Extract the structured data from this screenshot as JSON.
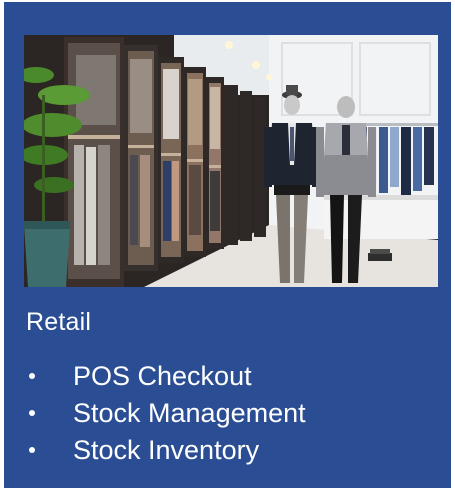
{
  "heading": "Retail",
  "items": [
    {
      "label": "POS Checkout"
    },
    {
      "label": "Stock Management"
    },
    {
      "label": "Stock Inventory"
    }
  ],
  "colors": {
    "card_background": "#2a4d94",
    "text": "#ffffff"
  },
  "image": {
    "subject": "clothing-store-interior-photo"
  }
}
